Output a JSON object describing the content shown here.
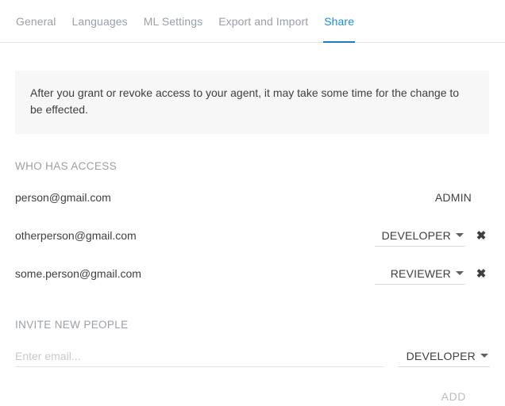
{
  "tabs": [
    {
      "label": "General",
      "active": false
    },
    {
      "label": "Languages",
      "active": false
    },
    {
      "label": "ML Settings",
      "active": false
    },
    {
      "label": "Export and Import",
      "active": false
    },
    {
      "label": "Share",
      "active": true
    }
  ],
  "notice": {
    "text": "After you grant or revoke access to your agent, it may take some time for the change to be effected."
  },
  "access": {
    "section_title": "WHO HAS ACCESS",
    "rows": [
      {
        "email": "person@gmail.com",
        "role": "ADMIN",
        "editable": false,
        "removable": false
      },
      {
        "email": "otherperson@gmail.com",
        "role": "DEVELOPER",
        "editable": true,
        "removable": true
      },
      {
        "email": "some.person@gmail.com",
        "role": "REVIEWER",
        "editable": true,
        "removable": true
      }
    ],
    "remove_icon": "✖"
  },
  "invite": {
    "section_title": "INVITE NEW PEOPLE",
    "email_placeholder": "Enter email...",
    "email_value": "",
    "role": "DEVELOPER",
    "add_label": "ADD"
  },
  "colors": {
    "accent": "#1a8cd8",
    "accent_underline": "#1a7fc1",
    "muted": "#9aa0a6",
    "text": "#3c4043",
    "notice_bg": "#f7f7f8",
    "disabled": "#b9bcbf"
  }
}
